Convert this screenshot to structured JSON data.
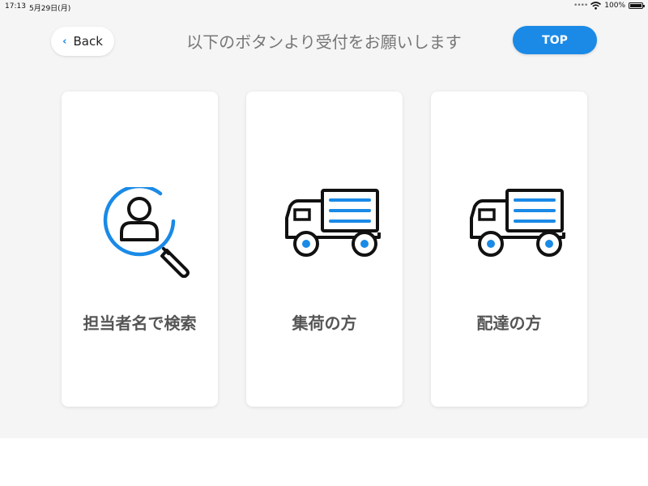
{
  "status_bar": {
    "time": "17:13",
    "date": "5月29日(月)",
    "battery": "100%"
  },
  "header": {
    "back_label": "Back",
    "title": "以下のボタンより受付をお願いします",
    "top_label": "TOP"
  },
  "cards": [
    {
      "label": "担当者名で検索",
      "icon": "person-search-icon"
    },
    {
      "label": "集荷の方",
      "icon": "truck-icon"
    },
    {
      "label": "配達の方",
      "icon": "truck-icon"
    }
  ],
  "colors": {
    "accent": "#1a8ae6",
    "background": "#f5f5f5",
    "card": "#ffffff",
    "text": "#555555"
  }
}
